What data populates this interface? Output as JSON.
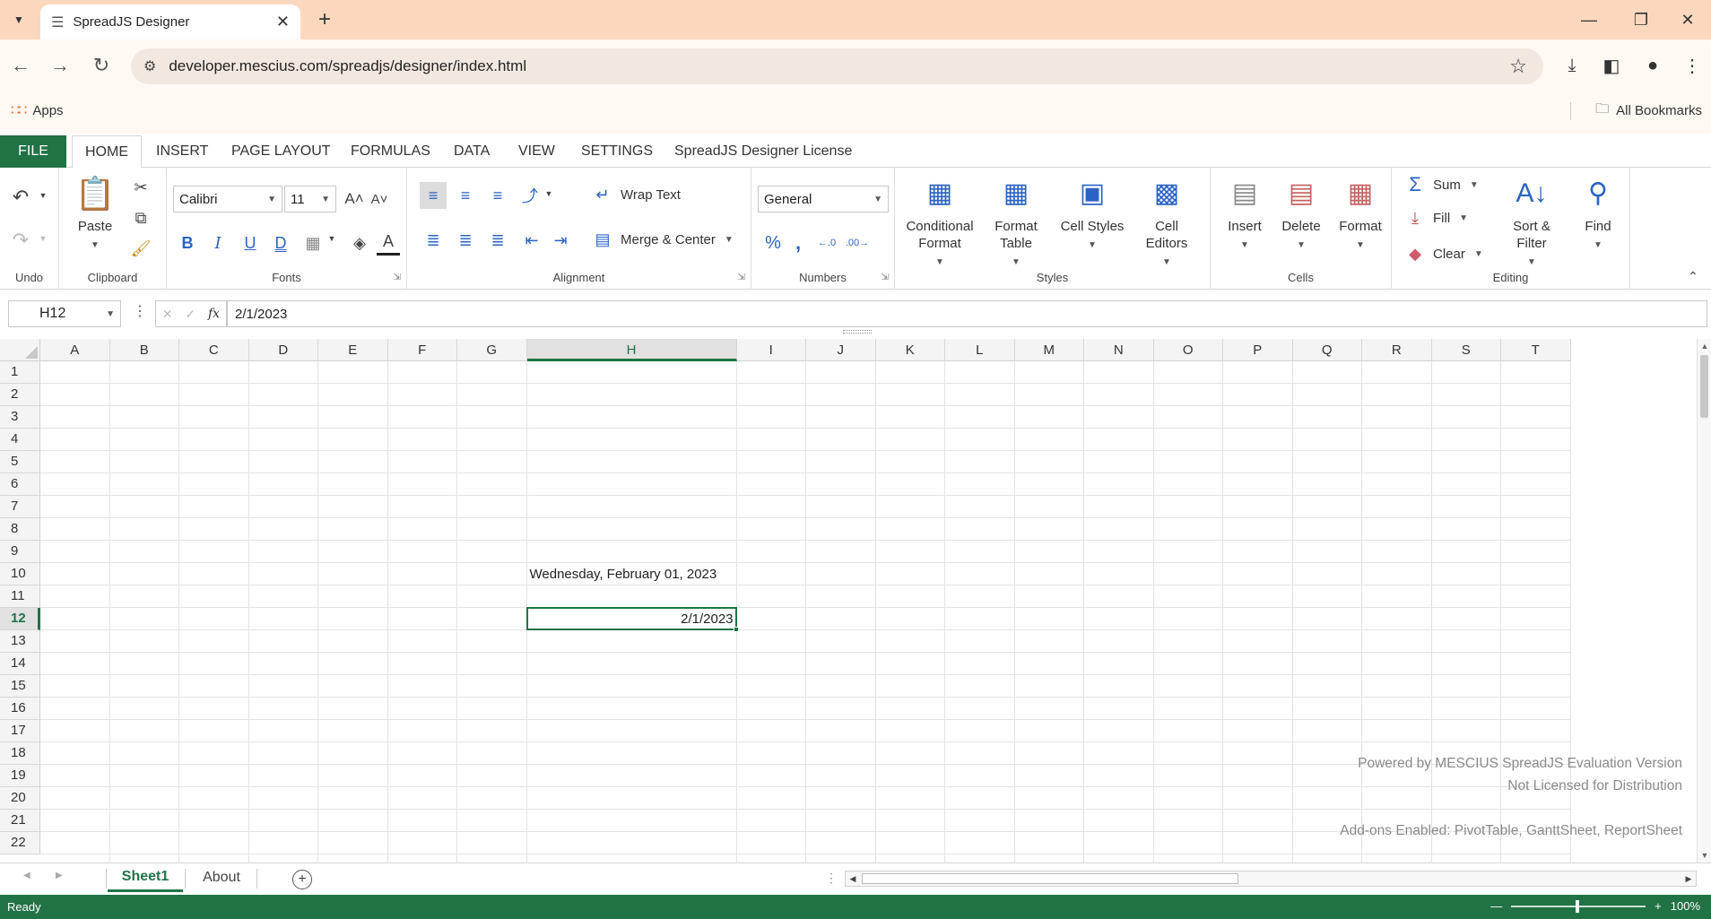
{
  "browser": {
    "tab_title": "SpreadJS Designer",
    "url": "developer.mescius.com/spreadjs/designer/index.html",
    "bookmarks_apps": "Apps",
    "bookmarks_all": "All Bookmarks"
  },
  "ribbon": {
    "tabs": [
      "FILE",
      "HOME",
      "INSERT",
      "PAGE LAYOUT",
      "FORMULAS",
      "DATA",
      "VIEW",
      "SETTINGS",
      "SpreadJS Designer License"
    ],
    "active_tab": "HOME",
    "groups": {
      "undo": "Undo",
      "clipboard": "Clipboard",
      "fonts": "Fonts",
      "alignment": "Alignment",
      "numbers": "Numbers",
      "styles": "Styles",
      "cells": "Cells",
      "editing": "Editing"
    },
    "paste": "Paste",
    "font_name": "Calibri",
    "font_size": "11",
    "wrap_text": "Wrap Text",
    "merge_center": "Merge & Center",
    "number_format": "General",
    "styles_buttons": [
      {
        "line1": "Conditional",
        "line2": "Format"
      },
      {
        "line1": "Format",
        "line2": "Table"
      },
      {
        "line1": "Cell Styles",
        "line2": ""
      },
      {
        "line1": "Cell",
        "line2": "Editors"
      }
    ],
    "cells_buttons": [
      "Insert",
      "Delete",
      "Format"
    ],
    "editing": {
      "sum": "Sum",
      "fill": "Fill",
      "clear": "Clear",
      "sort_line1": "Sort &",
      "sort_line2": "Filter",
      "find": "Find"
    }
  },
  "formula_bar": {
    "name_box": "H12",
    "formula": "2/1/2023",
    "fx": "fx"
  },
  "sheet": {
    "columns": [
      "A",
      "B",
      "C",
      "D",
      "E",
      "F",
      "G",
      "H",
      "I",
      "J",
      "K",
      "L",
      "M",
      "N",
      "O",
      "P",
      "Q",
      "R",
      "S",
      "T"
    ],
    "rows": [
      "1",
      "2",
      "3",
      "4",
      "5",
      "6",
      "7",
      "8",
      "9",
      "10",
      "11",
      "12",
      "13",
      "14",
      "15",
      "16",
      "17",
      "18",
      "19",
      "20",
      "21",
      "22"
    ],
    "selected_column": "H",
    "selected_row": "12",
    "cells": {
      "H10": "Wednesday, February 01, 2023",
      "H12": "2/1/2023"
    },
    "watermark": [
      "Powered by MESCIUS SpreadJS Evaluation Version",
      "Not Licensed for Distribution",
      "Add-ons Enabled: PivotTable, GanttSheet, ReportSheet"
    ]
  },
  "sheet_tabs": [
    "Sheet1",
    "About"
  ],
  "active_sheet": "Sheet1",
  "status": {
    "ready": "Ready",
    "zoom": "100%"
  },
  "colors": {
    "accent": "#217346",
    "browser_frame": "#fbd8bd"
  }
}
